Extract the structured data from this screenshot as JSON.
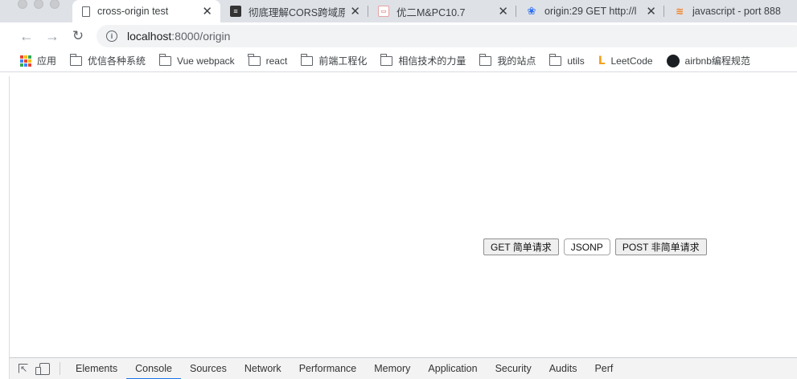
{
  "tabs": [
    {
      "title": "cross-origin test",
      "favicon": "document-icon",
      "active": true
    },
    {
      "title": "彻底理解CORS跨域原",
      "favicon": "juejin-icon"
    },
    {
      "title": "优二M&PC10.7",
      "favicon": "web-icon"
    },
    {
      "title": "origin:29 GET http://l",
      "favicon": "baidu-paw-icon"
    },
    {
      "title": "javascript - port 888",
      "favicon": "stackoverflow-icon"
    }
  ],
  "tab_close": "✕",
  "address_bar": {
    "host": "localhost",
    "path": ":8000/origin"
  },
  "bookmarks": [
    {
      "label": "应用",
      "icon": "apps-icon"
    },
    {
      "label": "优信各种系统",
      "icon": "folder-icon"
    },
    {
      "label": "Vue webpack",
      "icon": "folder-icon"
    },
    {
      "label": "react",
      "icon": "folder-icon"
    },
    {
      "label": "前端工程化",
      "icon": "folder-icon"
    },
    {
      "label": "相信技术的力量",
      "icon": "folder-icon"
    },
    {
      "label": "我的站点",
      "icon": "folder-icon"
    },
    {
      "label": "utils",
      "icon": "folder-icon"
    },
    {
      "label": "LeetCode",
      "icon": "leetcode-icon"
    },
    {
      "label": "airbnb编程规范",
      "icon": "github-icon"
    }
  ],
  "page": {
    "buttons": {
      "get": "GET 简单请求",
      "jsonp": "JSONP",
      "post": "POST 非简单请求"
    }
  },
  "devtools": {
    "tabs": [
      "Elements",
      "Console",
      "Sources",
      "Network",
      "Performance",
      "Memory",
      "Application",
      "Security",
      "Audits",
      "Perf"
    ],
    "active_tab": "Console"
  },
  "colors": {
    "tabstrip": "#dee1e6",
    "devtools_active_underline": "#1a73e8"
  }
}
